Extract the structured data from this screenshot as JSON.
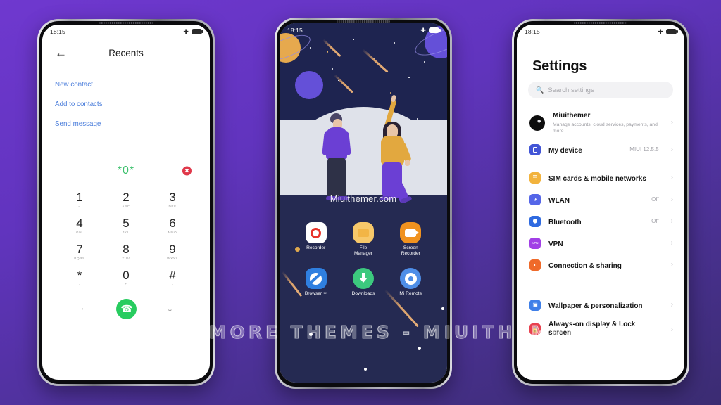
{
  "background": {
    "color_top": "#6f38cf",
    "color_bottom": "#3b2c72"
  },
  "watermark": {
    "text": "VISIT  FOR  MORE  THEMES  -  MIUITHEMER.COM"
  },
  "phone_dialer": {
    "status": {
      "time": "18:15",
      "airplane_icon": "airplane-icon",
      "battery_icon": "battery-icon"
    },
    "header": {
      "back_icon": "back-arrow-icon",
      "title": "Recents"
    },
    "actions": [
      "New contact",
      "Add to contacts",
      "Send message"
    ],
    "number_display": "*0*",
    "delete_icon": "delete-backspace-icon",
    "keypad": [
      {
        "digit": "1",
        "sub": "–"
      },
      {
        "digit": "2",
        "sub": "ABC"
      },
      {
        "digit": "3",
        "sub": "DEF"
      },
      {
        "digit": "4",
        "sub": "GHI"
      },
      {
        "digit": "5",
        "sub": "JKL"
      },
      {
        "digit": "6",
        "sub": "MNO"
      },
      {
        "digit": "7",
        "sub": "PQRS"
      },
      {
        "digit": "8",
        "sub": "TUV"
      },
      {
        "digit": "9",
        "sub": "WXYZ"
      },
      {
        "digit": "*",
        "sub": ","
      },
      {
        "digit": "0",
        "sub": "+"
      },
      {
        "digit": "#",
        "sub": ";"
      }
    ],
    "bottom": {
      "dots_icon": "keypad-more-icon",
      "call_icon": "call-phone-icon",
      "collapse_icon": "chevron-down-icon"
    },
    "colors": {
      "action_link": "#4a7ddb",
      "number": "#3ec16e",
      "call_button": "#27cc5f",
      "delete": "#e0384a"
    }
  },
  "phone_home": {
    "status": {
      "time": "18:15",
      "airplane_icon": "airplane-icon",
      "battery_icon": "battery-icon"
    },
    "wallpaper_watermark": "Miuithemer.com",
    "apps_row1": [
      {
        "label": "Recorder",
        "icon": "recorder-icon",
        "bg": "#ffffff",
        "fg": "#e8332a"
      },
      {
        "label": "File\nManager",
        "icon": "file-manager-icon",
        "bg": "#f7c86a",
        "fg": "#ffffff"
      },
      {
        "label": "Screen\nRecorder",
        "icon": "screen-recorder-icon",
        "bg": "#f0921f",
        "fg": "#ffffff"
      }
    ],
    "apps_row2": [
      {
        "label": "Browser ✶",
        "icon": "browser-icon",
        "bg": "#2f7fe0",
        "fg": "#ffffff"
      },
      {
        "label": "Downloads",
        "icon": "downloads-icon",
        "bg": "#3cc97e",
        "fg": "#ffffff"
      },
      {
        "label": "Mi Remote",
        "icon": "mi-remote-icon",
        "bg": "#4e8ee8",
        "fg": "#ffffff"
      }
    ],
    "colors": {
      "sky": "#1e2450",
      "ground": "#dfe2ea",
      "lower": "#252a52"
    }
  },
  "phone_settings": {
    "status": {
      "time": "18:15",
      "airplane_icon": "airplane-icon",
      "battery_icon": "battery-icon"
    },
    "title": "Settings",
    "search": {
      "icon": "search-icon",
      "placeholder": "Search settings"
    },
    "account": {
      "name": "Miuithemer",
      "subtitle": "Manage accounts, cloud services, payments, and more",
      "avatar_icon": "user-avatar",
      "chevron_icon": "chevron-right-icon"
    },
    "items": [
      {
        "label": "My device",
        "value": "MIUI 12.5.5",
        "icon": "device-icon",
        "color": "#4255d6"
      },
      {
        "label": "SIM cards & mobile networks",
        "value": "",
        "icon": "sim-card-icon",
        "color": "#f2b33d"
      },
      {
        "label": "WLAN",
        "value": "Off",
        "icon": "wifi-icon",
        "color": "#5566e8"
      },
      {
        "label": "Bluetooth",
        "value": "Off",
        "icon": "bluetooth-icon",
        "color": "#2f6ae0"
      },
      {
        "label": "VPN",
        "value": "",
        "icon": "vpn-icon",
        "color": "#a13fe6"
      },
      {
        "label": "Connection & sharing",
        "value": "",
        "icon": "connection-sharing-icon",
        "color": "#ef6a2a"
      },
      {
        "label": "Wallpaper & personalization",
        "value": "",
        "icon": "wallpaper-icon",
        "color": "#3f7fe8"
      },
      {
        "label": "Always-on display & Lock screen",
        "value": "",
        "icon": "lock-icon",
        "color": "#e8414f"
      }
    ]
  }
}
